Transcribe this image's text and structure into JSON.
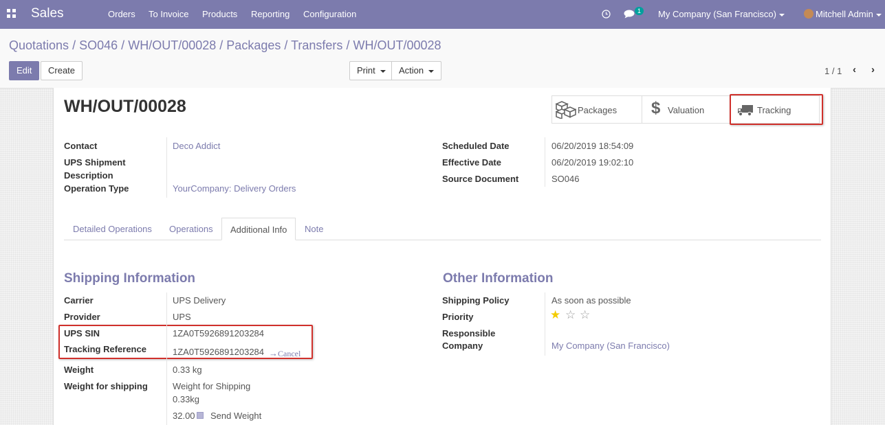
{
  "navbar": {
    "app_name": "Sales",
    "menu": [
      "Orders",
      "To Invoice",
      "Products",
      "Reporting",
      "Configuration"
    ],
    "messages_count": "1",
    "company": "My Company (San Francisco)",
    "user": "Mitchell Admin"
  },
  "breadcrumb": {
    "items": [
      "Quotations",
      "SO046",
      "WH/OUT/00028",
      "Packages",
      "Transfers"
    ],
    "separator": "/",
    "current": "WH/OUT/00028"
  },
  "toolbar": {
    "edit_label": "Edit",
    "create_label": "Create",
    "print_label": "Print",
    "action_label": "Action",
    "pager": "1 / 1"
  },
  "record": {
    "title": "WH/OUT/00028",
    "smart_buttons": {
      "packages": "Packages",
      "valuation": "Valuation",
      "tracking": "Tracking"
    },
    "fields_left": {
      "contact_label": "Contact",
      "contact_value": "Deco Addict",
      "ups_desc_label_1": "UPS Shipment",
      "ups_desc_label_2": "Description",
      "operation_type_label": "Operation Type",
      "operation_type_value": "YourCompany: Delivery Orders"
    },
    "fields_right": {
      "scheduled_label": "Scheduled Date",
      "scheduled_value": "06/20/2019 18:54:09",
      "effective_label": "Effective Date",
      "effective_value": "06/20/2019 19:02:10",
      "source_label": "Source Document",
      "source_value": "SO046"
    },
    "tabs": [
      "Detailed Operations",
      "Operations",
      "Additional Info",
      "Note"
    ],
    "active_tab": "Additional Info"
  },
  "shipping": {
    "title": "Shipping Information",
    "carrier_label": "Carrier",
    "carrier_value": "UPS Delivery",
    "provider_label": "Provider",
    "provider_value": "UPS",
    "sin_label": "UPS SIN",
    "sin_value": "1ZA0T5926891203284",
    "tracking_label": "Tracking Reference",
    "tracking_value": "1ZA0T5926891203284",
    "cancel_label": "Cancel",
    "weight_label": "Weight",
    "weight_value": "0.33 kg",
    "wfs_label": "Weight for shipping",
    "wfs_line1": "Weight for Shipping",
    "wfs_line2": "0.33kg",
    "wfs_value": "32.00",
    "send_weight_label": "Send Weight"
  },
  "other": {
    "title": "Other Information",
    "policy_label": "Shipping Policy",
    "policy_value": "As soon as possible",
    "priority_label": "Priority",
    "priority_stars": 1,
    "priority_max": 3,
    "resp_label_1": "Responsible",
    "resp_label_2": "Company",
    "resp_value": "My Company (San Francisco)"
  },
  "colors": {
    "brand": "#7c7bad",
    "highlight": "#d0302b",
    "star": "#f3cc00"
  }
}
